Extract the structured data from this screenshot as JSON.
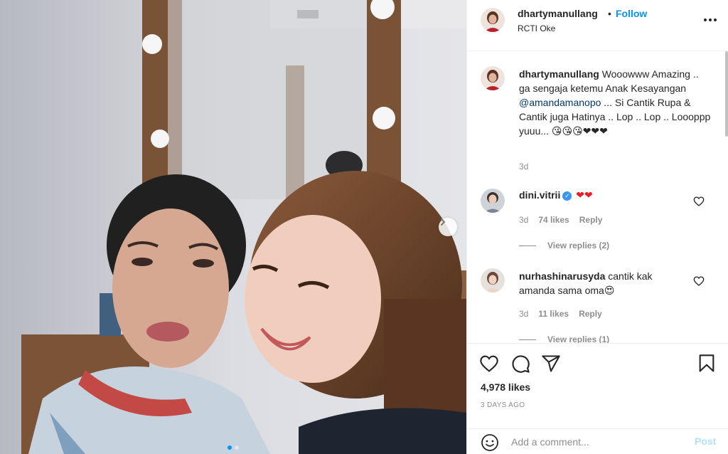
{
  "header": {
    "username": "dhartymanullang",
    "separator": "•",
    "follow_label": "Follow",
    "location": "RCTI Oke",
    "more_icon": "more-horizontal-icon"
  },
  "caption": {
    "username": "dhartymanullang",
    "text_before_mention": "Wooowww Amazing .. ga sengaja ketemu Anak Kesayangan ",
    "mention": "@amandamanopo",
    "text_after_mention": " ... Si Cantik Rupa & Cantik juga Hatinya .. Lop .. Lop .. Loooppp yuuu... ",
    "emojis": "😘😘😘❤❤❤",
    "time": "3d"
  },
  "comments": [
    {
      "username": "dini.vitrii",
      "verified": true,
      "text": "❤❤",
      "time": "3d",
      "likes": "74 likes",
      "reply_label": "Reply",
      "view_replies": "View replies (2)"
    },
    {
      "username": "nurhashinarusyda",
      "verified": false,
      "text": "cantik kak amanda sama oma😍",
      "time": "3d",
      "likes": "11 likes",
      "reply_label": "Reply",
      "view_replies": "View replies (1)"
    }
  ],
  "actions": {
    "like_icon": "heart-icon",
    "comment_icon": "comment-icon",
    "share_icon": "share-icon",
    "save_icon": "bookmark-icon",
    "likes_total": "4,978 likes",
    "posted": "3 DAYS AGO"
  },
  "add_comment": {
    "placeholder": "Add a comment...",
    "post_label": "Post",
    "emoji_icon": "emoji-smiley-icon"
  },
  "carousel": {
    "next_icon": "chevron-right-icon",
    "slide_count": 2,
    "active_slide": 1
  },
  "colors": {
    "accent": "#0095f6",
    "mention": "#00376b",
    "secondary_text": "#8e8e8e",
    "post_disabled": "#b2dffc",
    "heart": "#ed1c24"
  }
}
